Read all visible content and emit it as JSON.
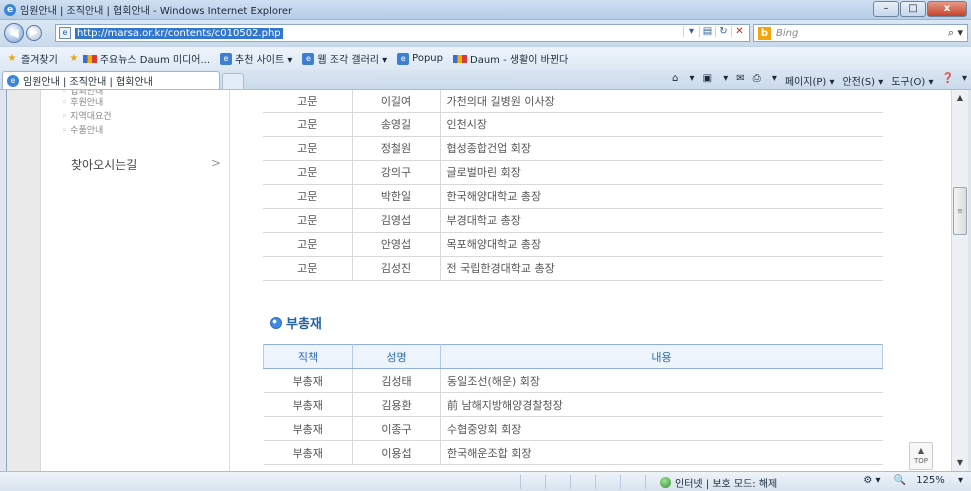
{
  "window": {
    "title": "임원안내 | 조직안내 | 협회안내 - Windows Internet Explorer",
    "minimize": "–",
    "maximize": "□",
    "close": "x"
  },
  "address": {
    "url": "http://marsa.or.kr/contents/c010502.php",
    "search_placeholder": "Bing"
  },
  "favorites": [
    {
      "label": "즐겨찾기",
      "icon": "star-icon"
    },
    {
      "label": "주요뉴스 Daum 미디어...",
      "icon": "daum-icon"
    },
    {
      "label": "추천 사이트 ▾",
      "icon": "ie-icon"
    },
    {
      "label": "웹 조각 갤러리 ▾",
      "icon": "page-icon"
    },
    {
      "label": "Popup",
      "icon": "page-icon"
    },
    {
      "label": "Daum - 생활이 바뀐다",
      "icon": "daum-icon"
    }
  ],
  "tab": {
    "label": "임원안내 | 조직안내 | 협회안내"
  },
  "commands": [
    "▾",
    "▾",
    "▾",
    "페이지(P) ▾",
    "안전(S) ▾",
    "도구(O) ▾",
    "▾"
  ],
  "sidebar": {
    "submenu": [
      "업회안내",
      "후원안내",
      "지역대요건",
      "수품안내"
    ],
    "main_item": "찾아오시는길",
    "chevron": ">"
  },
  "advisors": [
    {
      "role": "고문",
      "name": "이길여",
      "desc": "가천의대 길병원 이사장"
    },
    {
      "role": "고문",
      "name": "송영길",
      "desc": "인천시장"
    },
    {
      "role": "고문",
      "name": "정철원",
      "desc": "협성종합건업 회장"
    },
    {
      "role": "고문",
      "name": "강의구",
      "desc": "글로벌마린 회장"
    },
    {
      "role": "고문",
      "name": "박한일",
      "desc": "한국해양대학교 총장"
    },
    {
      "role": "고문",
      "name": "김영섭",
      "desc": "부경대학교 총장"
    },
    {
      "role": "고문",
      "name": "안영섭",
      "desc": "목포해양대학교 총장"
    },
    {
      "role": "고문",
      "name": "김성진",
      "desc": "전 국립한경대학교 총장"
    }
  ],
  "vp_section": {
    "title": "부총재",
    "headers": [
      "직책",
      "성명",
      "내용"
    ],
    "rows": [
      {
        "role": "부총재",
        "name": "김성태",
        "desc": "동일조선(해운) 회장"
      },
      {
        "role": "부총재",
        "name": "김용환",
        "desc": "前 남해지방해양경찰청장"
      },
      {
        "role": "부총재",
        "name": "이종구",
        "desc": "수협중앙회 회장"
      },
      {
        "role": "부총재",
        "name": "이용섭",
        "desc": "한국해운조합 회장"
      }
    ]
  },
  "top_button": "TOP",
  "status": {
    "zone": "인터넷 | 보호 모드: 해제",
    "zoom": "125%",
    "zoom_arrow": "▾"
  }
}
